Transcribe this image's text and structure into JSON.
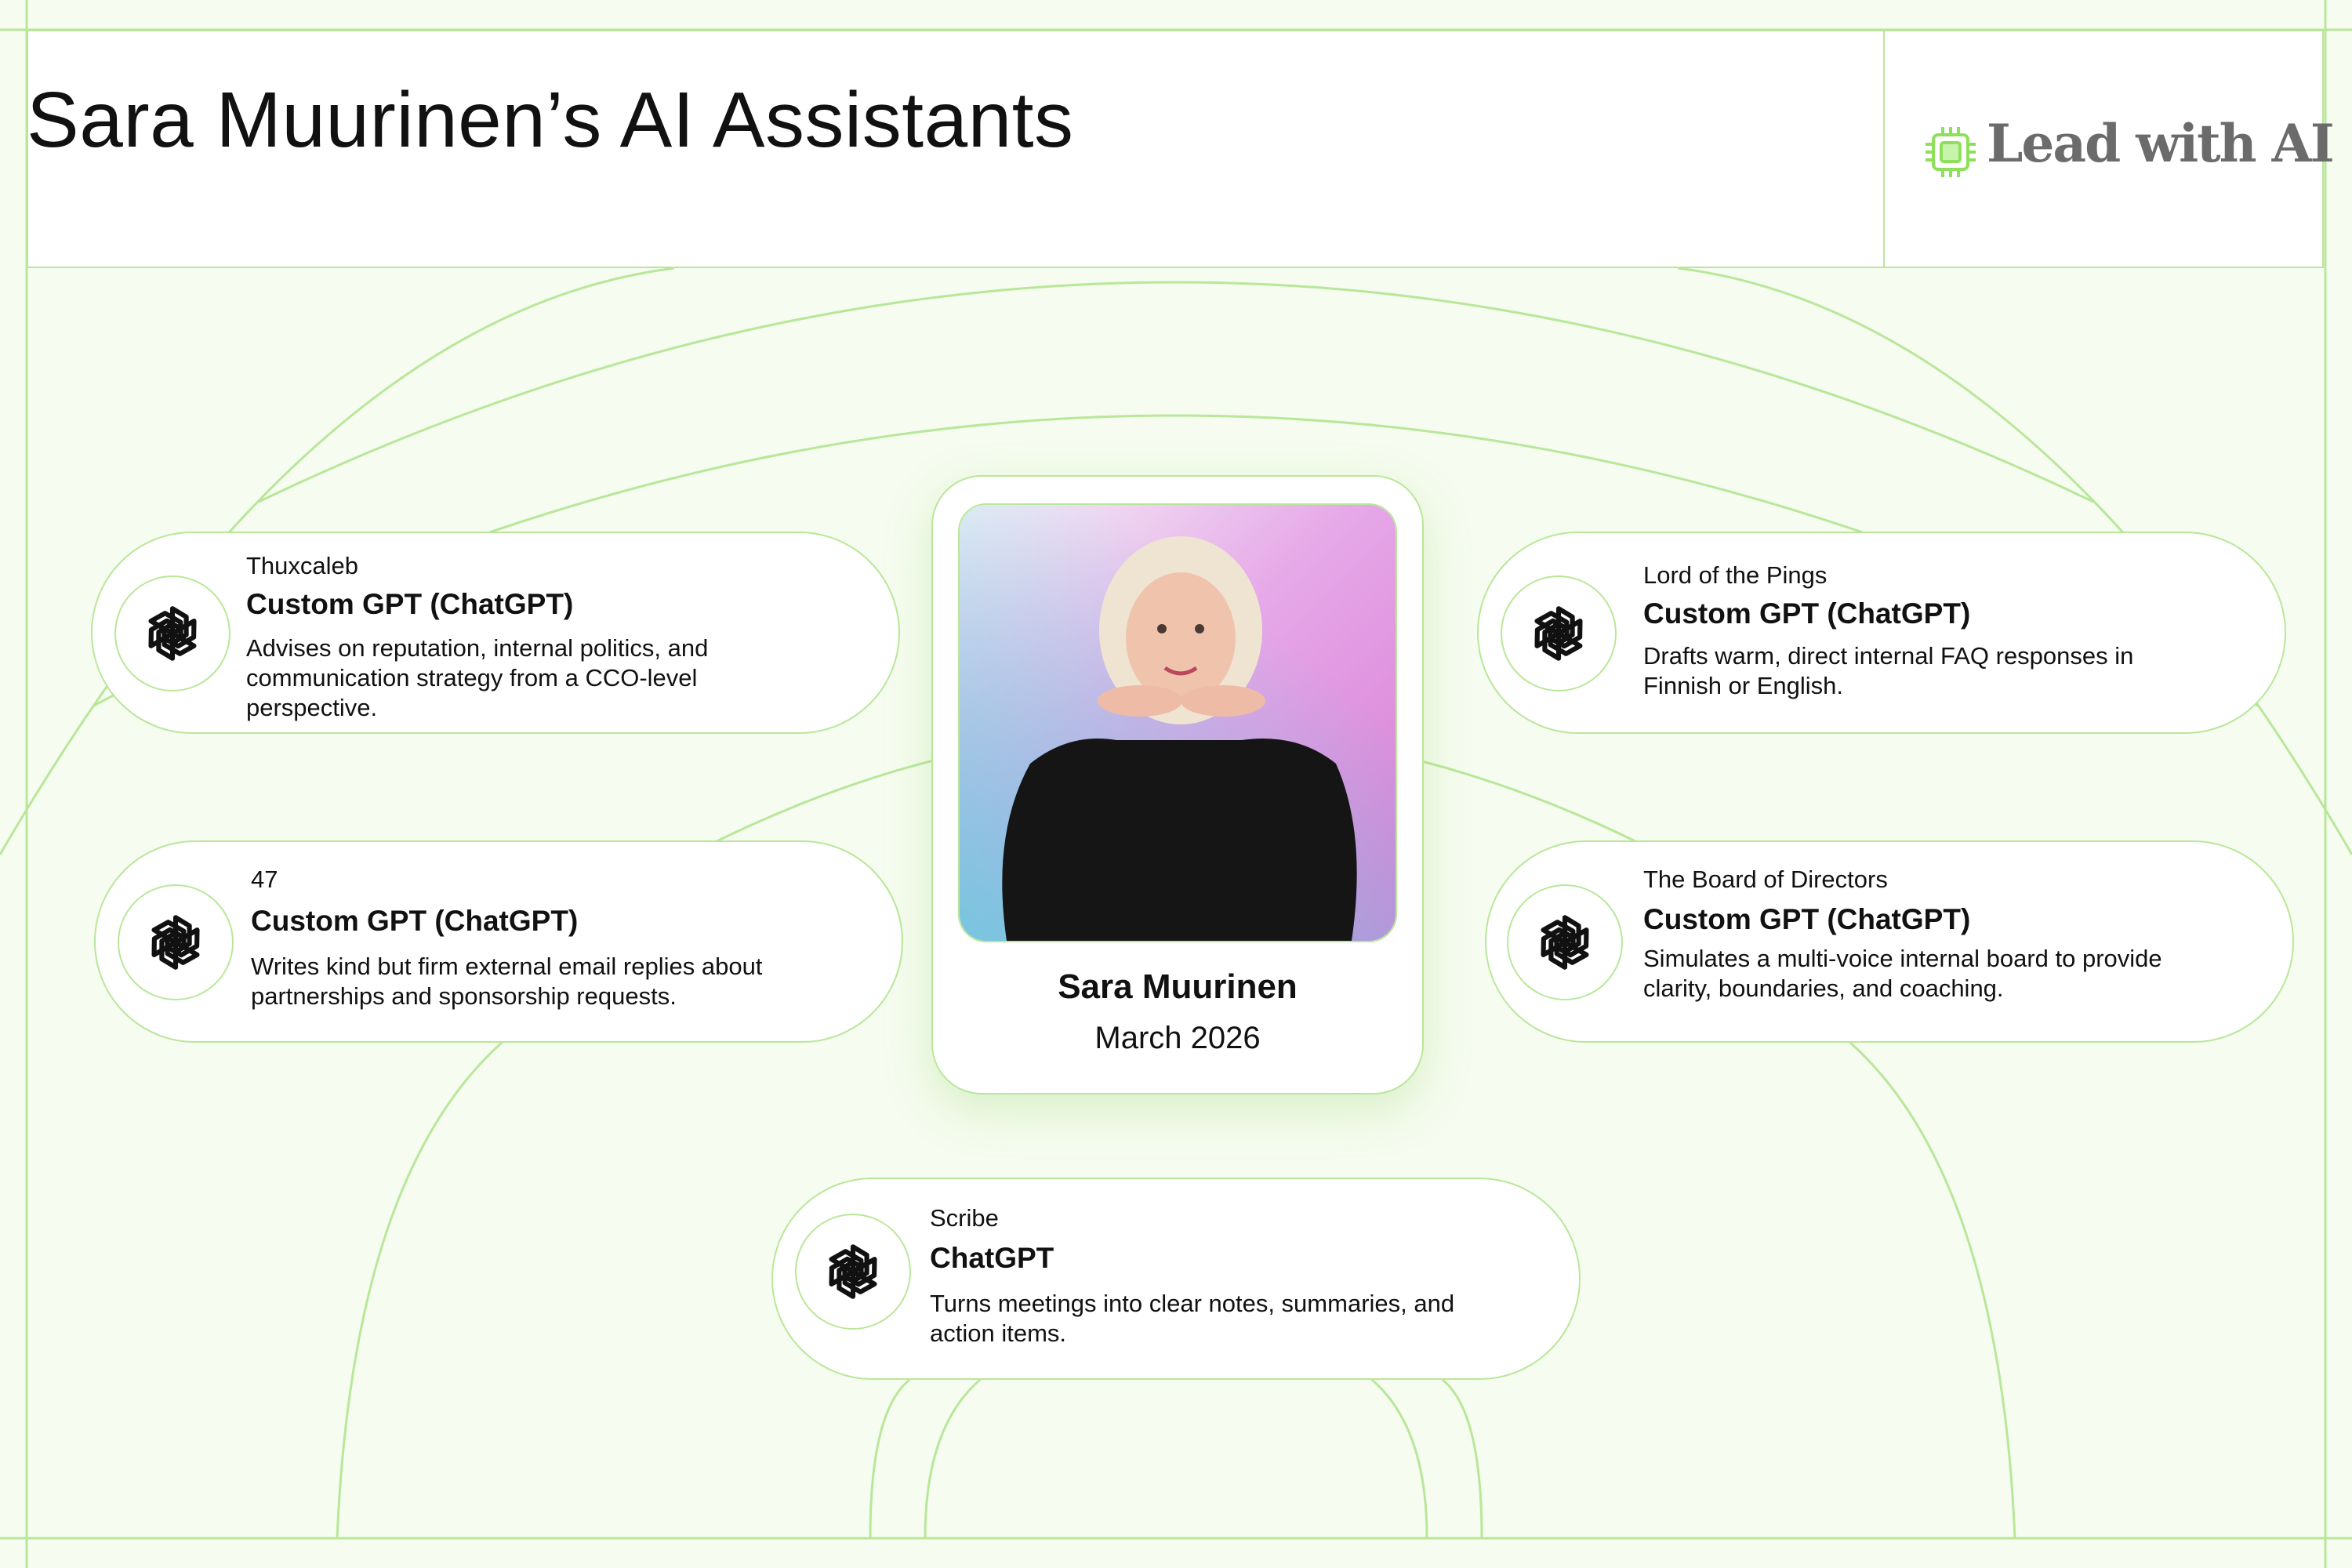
{
  "header": {
    "title": "Sara Muurinen’s AI Assistants",
    "logo_text": "Lead with AI"
  },
  "profile": {
    "name": "Sara Muurinen",
    "date": "March 2026"
  },
  "assistants": [
    {
      "name": "Thuxcaleb",
      "tool": "Custom GPT (ChatGPT)",
      "description": "Advises on reputation, internal politics, and communication strategy from a CCO-level perspective.",
      "icon": "openai-icon"
    },
    {
      "name": "47",
      "tool": "Custom GPT (ChatGPT)",
      "description": "Writes kind but firm external email replies about partnerships and sponsorship requests.",
      "icon": "openai-icon"
    },
    {
      "name": "Lord of the Pings",
      "tool": "Custom GPT (ChatGPT)",
      "description": "Drafts warm, direct internal FAQ responses in Finnish or English.",
      "icon": "openai-icon"
    },
    {
      "name": "The Board of Directors",
      "tool": "Custom GPT (ChatGPT)",
      "description": "Simulates a multi-voice internal board to provide clarity, boundaries, and coaching.",
      "icon": "openai-icon"
    },
    {
      "name": "Scribe",
      "tool": "ChatGPT",
      "description": "Turns meetings into clear notes, summaries, and action items.",
      "icon": "openai-icon"
    }
  ],
  "colors": {
    "background": "#f6fcf0",
    "accent_line": "#b9e79a",
    "logo_green": "#8ee05a",
    "logo_text": "#6b6b6b"
  }
}
